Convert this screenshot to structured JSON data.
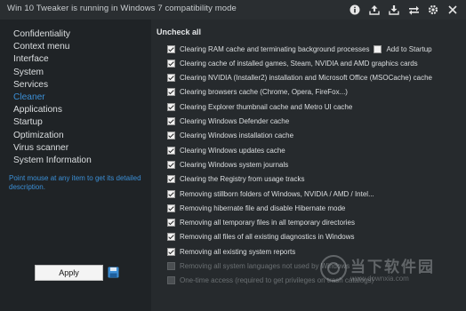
{
  "window": {
    "title": "Win 10 Tweaker is running in Windows 7 compatibility mode",
    "icons": [
      "info-icon",
      "upload-icon",
      "download-icon",
      "exchange-icon",
      "gear-icon",
      "close-icon"
    ]
  },
  "sidebar": {
    "items": [
      {
        "label": "Confidentiality"
      },
      {
        "label": "Context menu"
      },
      {
        "label": "Interface"
      },
      {
        "label": "System"
      },
      {
        "label": "Services"
      },
      {
        "label": "Cleaner",
        "active": true
      },
      {
        "label": "Applications"
      },
      {
        "label": "Startup"
      },
      {
        "label": "Optimization"
      },
      {
        "label": "Virus scanner"
      },
      {
        "label": "System Information"
      }
    ],
    "hint": "Point mouse at any item to get its detailed description.",
    "apply_label": "Apply",
    "save_icon": "save-icon"
  },
  "cleaner": {
    "uncheck_all_label": "Uncheck all",
    "add_to_startup_label": "Add to Startup",
    "options": [
      {
        "label": "Clearing RAM cache and terminating background processes",
        "checked": true
      },
      {
        "label": "Clearing cache of installed games, Steam, NVIDIA and AMD graphics cards",
        "checked": true
      },
      {
        "label": "Clearing NVIDIA (Installer2) installation and Microsoft Office (MSOCache) cache",
        "checked": true
      },
      {
        "label": "Clearing browsers cache (Chrome, Opera, FireFox...)",
        "checked": true
      },
      {
        "label": "Clearing Explorer thumbnail cache and Metro UI cache",
        "checked": true
      },
      {
        "label": "Clearing Windows Defender cache",
        "checked": true
      },
      {
        "label": "Clearing Windows installation cache",
        "checked": true
      },
      {
        "label": "Clearing Windows updates cache",
        "checked": true
      },
      {
        "label": "Clearing Windows system journals",
        "checked": true
      },
      {
        "label": "Clearing the Registry from usage tracks",
        "checked": true
      },
      {
        "label": "Removing stillborn folders of Windows, NVIDIA / AMD / Intel...",
        "checked": true
      },
      {
        "label": "Removing hibernate file and disable Hibernate mode",
        "checked": true
      },
      {
        "label": "Removing all temporary files in all temporary directories",
        "checked": true
      },
      {
        "label": "Removing all files of all existing diagnostics in Windows",
        "checked": true
      },
      {
        "label": "Removing all existing system reports",
        "checked": true
      },
      {
        "label": "Removing all system languages not used by Windows",
        "checked": false,
        "disabled": true
      },
      {
        "label": "One-time access (required to get privileges on trash catalogs)",
        "checked": false,
        "disabled": true
      }
    ]
  },
  "watermark": {
    "text": "当下软件园",
    "url": "www.downxia.com"
  }
}
